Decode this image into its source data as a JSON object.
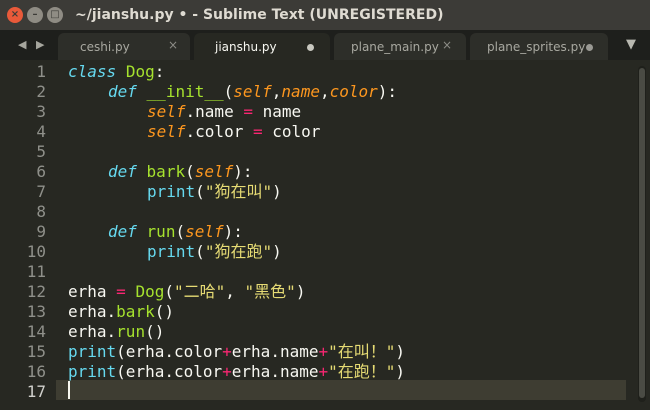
{
  "window": {
    "title": "~/jianshu.py • - Sublime Text (UNREGISTERED)",
    "close_glyph": "×",
    "minimize_glyph": "–",
    "maximize_glyph": "□"
  },
  "tabbar": {
    "nav_arrows": "◀ ▶",
    "menu_glyph": "▼",
    "tabs": [
      {
        "label": "ceshi.py",
        "state": "close",
        "glyph": "×"
      },
      {
        "label": "jianshu.py",
        "state": "dirty",
        "active": true
      },
      {
        "label": "plane_main.py",
        "state": "close",
        "glyph": "×"
      },
      {
        "label": "plane_sprites.py",
        "state": "dirty"
      }
    ]
  },
  "editor": {
    "current_line": 17,
    "line_numbers": [
      "1",
      "2",
      "3",
      "4",
      "5",
      "6",
      "7",
      "8",
      "9",
      "10",
      "11",
      "12",
      "13",
      "14",
      "15",
      "16",
      "17"
    ]
  },
  "code": {
    "l1": [
      "class",
      " ",
      "Dog",
      ":"
    ],
    "l2": [
      "def",
      " ",
      "__init__",
      "(",
      "self",
      ",",
      "name",
      ",",
      "color",
      "):"
    ],
    "l3": [
      "self",
      ".name ",
      "=",
      " name"
    ],
    "l4": [
      "self",
      ".color ",
      "=",
      " color"
    ],
    "l6": [
      "def",
      " ",
      "bark",
      "(",
      "self",
      "):"
    ],
    "l7": [
      "print",
      "(",
      "\"狗在叫\"",
      ")"
    ],
    "l9": [
      "def",
      " ",
      "run",
      "(",
      "self",
      "):"
    ],
    "l10": [
      "print",
      "(",
      "\"狗在跑\"",
      ")"
    ],
    "l12": [
      "erha ",
      "=",
      " ",
      "Dog",
      "(",
      "\"二哈\"",
      ", ",
      "\"黑色\"",
      ")"
    ],
    "l13": [
      "erha.",
      "bark",
      "()"
    ],
    "l14": [
      "erha.",
      "run",
      "()"
    ],
    "l15": [
      "print",
      "(erha.color",
      "+",
      "erha.name",
      "+",
      "\"在叫！\"",
      ")"
    ],
    "l16": [
      "print",
      "(erha.color",
      "+",
      "erha.name",
      "+",
      "\"在跑！\"",
      ")"
    ]
  },
  "colors": {
    "background": "#272822",
    "keyword": "#66d9ef",
    "function": "#a6e22e",
    "self": "#fd971f",
    "operator": "#f92672",
    "string": "#e6db74",
    "text": "#f8f8f2"
  }
}
